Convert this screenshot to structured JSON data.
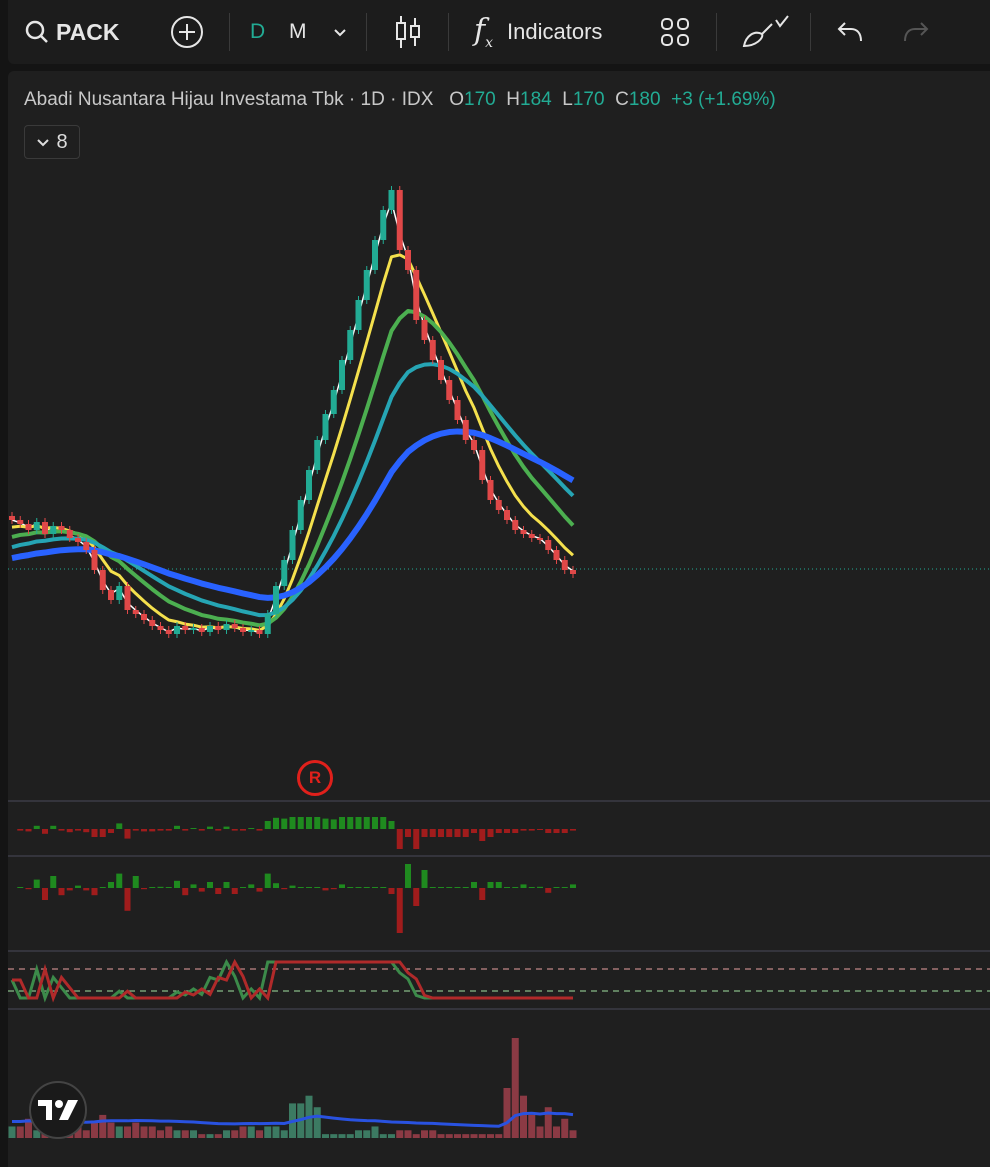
{
  "toolbar": {
    "symbol": "PACK",
    "interval_d": "D",
    "interval_m": "M",
    "indicators_label": "Indicators"
  },
  "legend": {
    "title": "Abadi Nusantara Hijau Investama Tbk · 1D · IDX",
    "o_label": "O",
    "o": "170",
    "h_label": "H",
    "h": "184",
    "l_label": "L",
    "l": "170",
    "c_label": "C",
    "c": "180",
    "change": "+3 (+1.69%)"
  },
  "indicators_count": "8",
  "event_marker": "R",
  "colors": {
    "up": "#22ab94",
    "down": "#e04848",
    "bg": "#1f1f1f"
  },
  "chart_data": {
    "type": "candlestick",
    "closes": [
      205,
      203,
      200,
      204,
      198,
      202,
      200,
      196,
      194,
      190,
      180,
      170,
      165,
      172,
      160,
      158,
      155,
      152,
      150,
      148,
      152,
      150,
      151,
      149,
      152,
      150,
      153,
      151,
      149,
      150,
      148,
      158,
      172,
      185,
      200,
      215,
      230,
      245,
      258,
      270,
      285,
      300,
      315,
      330,
      345,
      360,
      370,
      340,
      330,
      305,
      295,
      285,
      275,
      265,
      255,
      245,
      240,
      225,
      215,
      210,
      205,
      200,
      198,
      196,
      195,
      190,
      185,
      180,
      178
    ],
    "volume": [
      3,
      3,
      5,
      2,
      2,
      2,
      3,
      2,
      3,
      2,
      4,
      6,
      4,
      3,
      3,
      4,
      3,
      3,
      2,
      3,
      2,
      2,
      2,
      1,
      1,
      1,
      2,
      2,
      3,
      3,
      2,
      3,
      3,
      2,
      9,
      9,
      11,
      8,
      1,
      1,
      1,
      1,
      2,
      2,
      3,
      1,
      1,
      2,
      2,
      1,
      2,
      2,
      1,
      1,
      1,
      1,
      1,
      1,
      1,
      1,
      13,
      26,
      11,
      6,
      3,
      8,
      3,
      5,
      2
    ],
    "ma_colors": [
      "#ffffff",
      "#f4e04d",
      "#4caf50",
      "#26a5b4",
      "#2962ff"
    ]
  }
}
